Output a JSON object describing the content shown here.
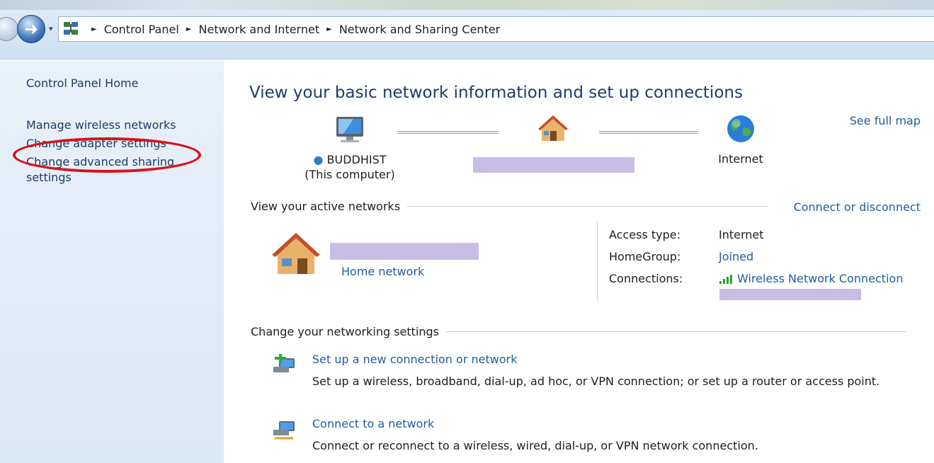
{
  "address_bar": {
    "dropdown_glyph": "▾",
    "breadcrumbs": [
      {
        "label": "Control Panel"
      },
      {
        "label": "Network and Internet"
      },
      {
        "label": "Network and Sharing Center"
      }
    ],
    "separator_glyph": "►"
  },
  "left_pane": {
    "items": [
      {
        "label": "Control Panel Home"
      },
      {
        "label": "Manage wireless networks"
      },
      {
        "label": "Change adapter settings"
      },
      {
        "label": "Change advanced sharing settings"
      }
    ]
  },
  "main": {
    "title": "View your basic network information and set up connections",
    "see_full_map": "See full map",
    "map": {
      "computer_name": "BUDDHIST",
      "computer_sub": "(This computer)",
      "internet": "Internet"
    },
    "active_networks": {
      "heading": "View your active networks",
      "connect_disconnect": "Connect or disconnect",
      "network_type": "Home network",
      "properties": [
        {
          "key": "Access type:",
          "value": "Internet",
          "is_link": false
        },
        {
          "key": "HomeGroup:",
          "value": "Joined",
          "is_link": true
        },
        {
          "key": "Connections:",
          "value": "Wireless Network Connection",
          "is_link": true
        }
      ]
    },
    "settings": {
      "heading": "Change your networking settings",
      "tasks": [
        {
          "link": "Set up a new connection or network",
          "desc": "Set up a wireless, broadband, dial-up, ad hoc, or VPN connection; or set up a router or access point."
        },
        {
          "link": "Connect to a network",
          "desc": "Connect or reconnect to a wireless, wired, dial-up, or VPN network connection."
        }
      ]
    }
  },
  "colors": {
    "link": "#1f5d9f",
    "title": "#1e3b6e",
    "annotation_red": "#d8141c",
    "redaction": "#c9bde6"
  }
}
